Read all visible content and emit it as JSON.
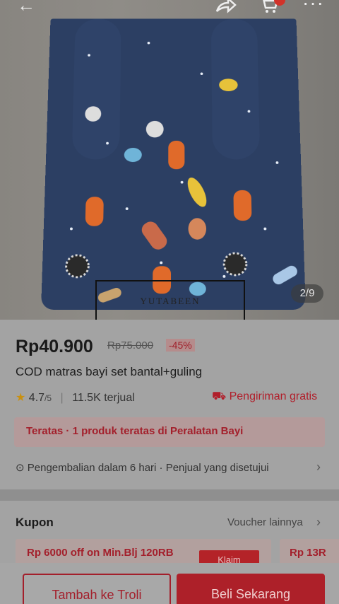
{
  "hero": {
    "image_counter": "2/9",
    "watermark": "YUTABEEN"
  },
  "header": {
    "back_icon": "arrow-left-icon",
    "share_icon": "share-icon",
    "cart_icon": "cart-icon",
    "more_icon": "more-icon"
  },
  "product": {
    "price": "Rp40.900",
    "original_price": "Rp75.000",
    "discount": "-45%",
    "title": "COD matras bayi set bantal+guling",
    "rating": "4.7",
    "rating_max": "/5",
    "sold": "11.5K terjual",
    "shipping": "Pengiriman gratis",
    "top_banner": "Teratas · 1 produk teratas di Peralatan Bayi",
    "returns": "Pengembalian dalam 6 hari · Penjual yang disetujui"
  },
  "kupon": {
    "title": "Kupon",
    "more_label": "Voucher lainnya",
    "coupon1": "Rp 6000 off on Min.Blj 120RB",
    "claim_label": "Klaim",
    "coupon2": "Rp 13R"
  },
  "bottom": {
    "add_to_cart": "Tambah ke Troli",
    "buy_now": "Beli Sekarang"
  },
  "colors": {
    "accent": "#a31f2b",
    "mat": "#2c3f63"
  }
}
